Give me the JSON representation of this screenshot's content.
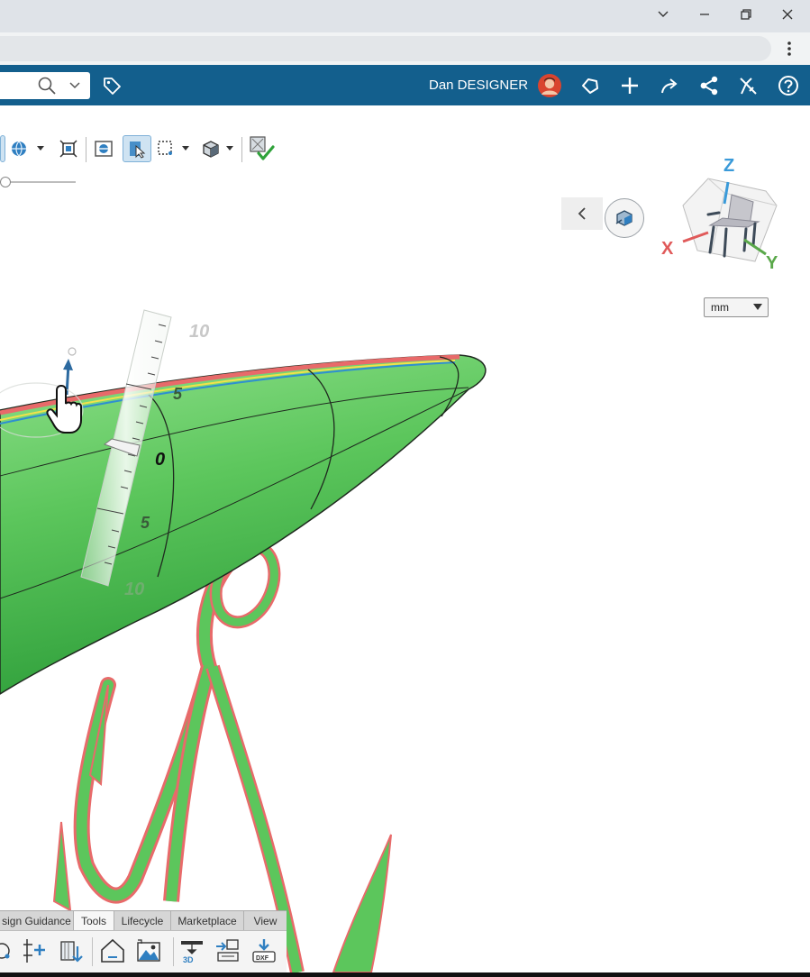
{
  "window": {
    "controls": [
      "chevron-down",
      "minimize",
      "restore",
      "close"
    ]
  },
  "header": {
    "user_name": "Dan DESIGNER",
    "accent": "#135f8d"
  },
  "viewport": {
    "units": {
      "selected": "mm"
    },
    "triad": {
      "x": "X",
      "y": "Y",
      "z": "Z"
    },
    "ruler": {
      "labels": [
        "10",
        "5",
        "0",
        "5",
        "10"
      ]
    }
  },
  "bottom_tabs": {
    "items": [
      "sign Guidance",
      "Tools",
      "Lifecycle",
      "Marketplace",
      "View"
    ],
    "active": "Tools"
  },
  "colors": {
    "model": "#5cc65c",
    "edge_highlight": "#e86a6a",
    "selection": "#2f8fd0"
  }
}
